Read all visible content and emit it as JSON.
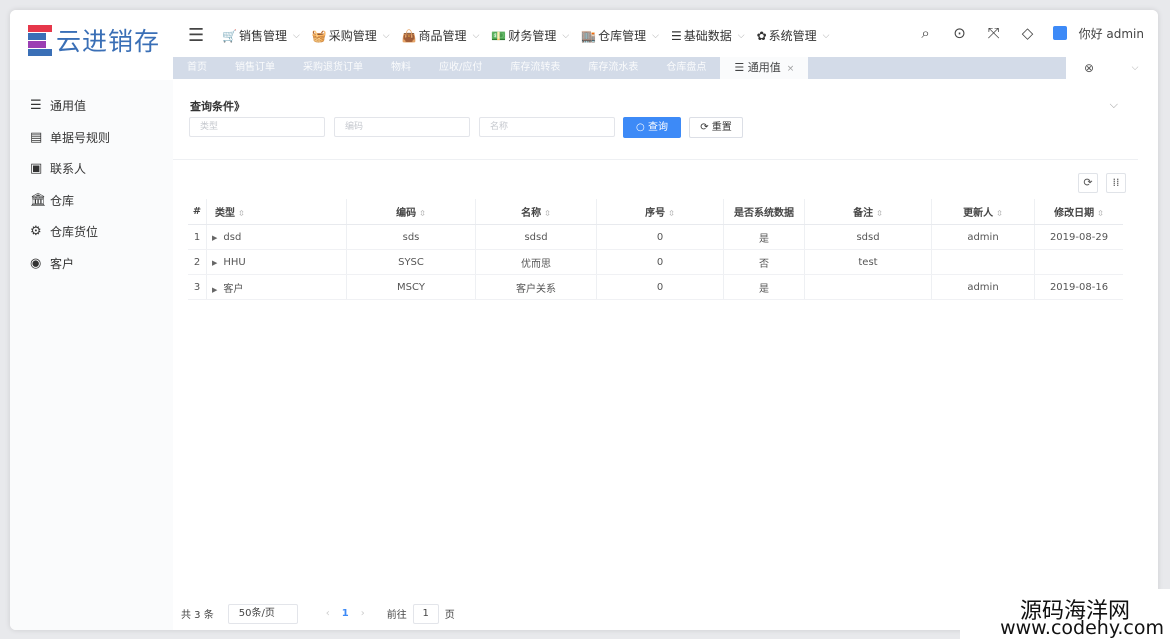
{
  "brand": {
    "name": "云进销存",
    "colors": [
      "#e6374a",
      "#3a6fb6",
      "#9b3fb3",
      "#3a6fb6"
    ]
  },
  "topnav": [
    {
      "icon": "🛒",
      "label": "销售管理"
    },
    {
      "icon": "🧺",
      "label": "采购管理"
    },
    {
      "icon": "👜",
      "label": "商品管理"
    },
    {
      "icon": "💵",
      "label": "财务管理"
    },
    {
      "icon": "🏬",
      "label": "仓库管理"
    },
    {
      "icon": "☰",
      "label": "基础数据"
    },
    {
      "icon": "✿",
      "label": "系统管理"
    }
  ],
  "header_tools": {
    "user": "你好 admin"
  },
  "tabs": [
    "首页",
    "销售订单",
    "采购退货订单",
    "物料",
    "应收/应付",
    "库存流转表",
    "库存流水表",
    "仓库盘点"
  ],
  "active_tab": "通用值",
  "sidebar": [
    {
      "icon": "☰",
      "label": "通用值"
    },
    {
      "icon": "▤",
      "label": "单据号规则"
    },
    {
      "icon": "▣",
      "label": "联系人"
    },
    {
      "icon": "🏛",
      "label": "仓库"
    },
    {
      "icon": "⚙",
      "label": "仓库货位"
    },
    {
      "icon": "◉",
      "label": "客户"
    }
  ],
  "query": {
    "title": "查询条件》",
    "inputs": [
      "类型",
      "编码",
      "名称"
    ],
    "search_label": "○ 查询",
    "reset_label": "⟳ 重置"
  },
  "table": {
    "columns": [
      "#",
      "类型",
      "编码",
      "名称",
      "序号",
      "是否系统数据",
      "备注",
      "更新人",
      "修改日期"
    ],
    "rows": [
      [
        "1",
        "dsd",
        "sds",
        "sdsd",
        "0",
        "是",
        "sdsd",
        "admin",
        "2019-08-29"
      ],
      [
        "2",
        "HHU",
        "SYSC",
        "优而思",
        "0",
        "否",
        "test",
        "",
        ""
      ],
      [
        "3",
        "客户",
        "MSCY",
        "客户关系",
        "0",
        "是",
        "",
        "admin",
        "2019-08-16"
      ]
    ]
  },
  "pagination": {
    "total": "共 3 条",
    "page_size": "50条/页",
    "current": "1",
    "goto_label": "前往",
    "goto_value": "1",
    "page_unit": "页"
  },
  "watermark": {
    "line1": "源码海洋网",
    "line2": "www.codehy.com"
  }
}
